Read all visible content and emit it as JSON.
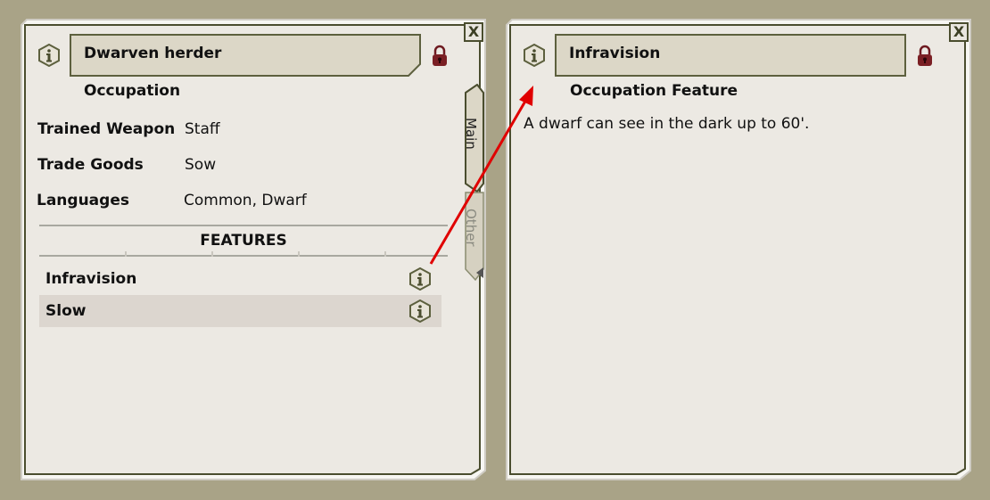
{
  "left_window": {
    "close_label": "X",
    "title": "Dwarven herder",
    "subtitle": "Occupation",
    "fields": [
      {
        "label": "Trained Weapon",
        "value": "Staff"
      },
      {
        "label": "Trade Goods",
        "value": "Sow"
      },
      {
        "label": "Languages",
        "value": "Common, Dwarf"
      }
    ],
    "features_header": "FEATURES",
    "features": [
      {
        "name": "Infravision"
      },
      {
        "name": "Slow"
      }
    ],
    "tabs": [
      {
        "label": "Main",
        "active": true
      },
      {
        "label": "Other",
        "active": false
      }
    ]
  },
  "right_window": {
    "close_label": "X",
    "title": "Infravision",
    "subtitle": "Occupation Feature",
    "description": "A dwarf can see in the dark up to 60'."
  },
  "colors": {
    "desktop_bg": "#a9a387",
    "panel_bg": "#ece9e3",
    "frame": "#4a4d2e",
    "title_bg": "#dcd7c7",
    "row_highlight": "#dcd6cf",
    "arrow": "#e00000",
    "lock": "#7a1f24"
  },
  "icons": [
    "info-icon",
    "lock-icon",
    "close-icon"
  ]
}
